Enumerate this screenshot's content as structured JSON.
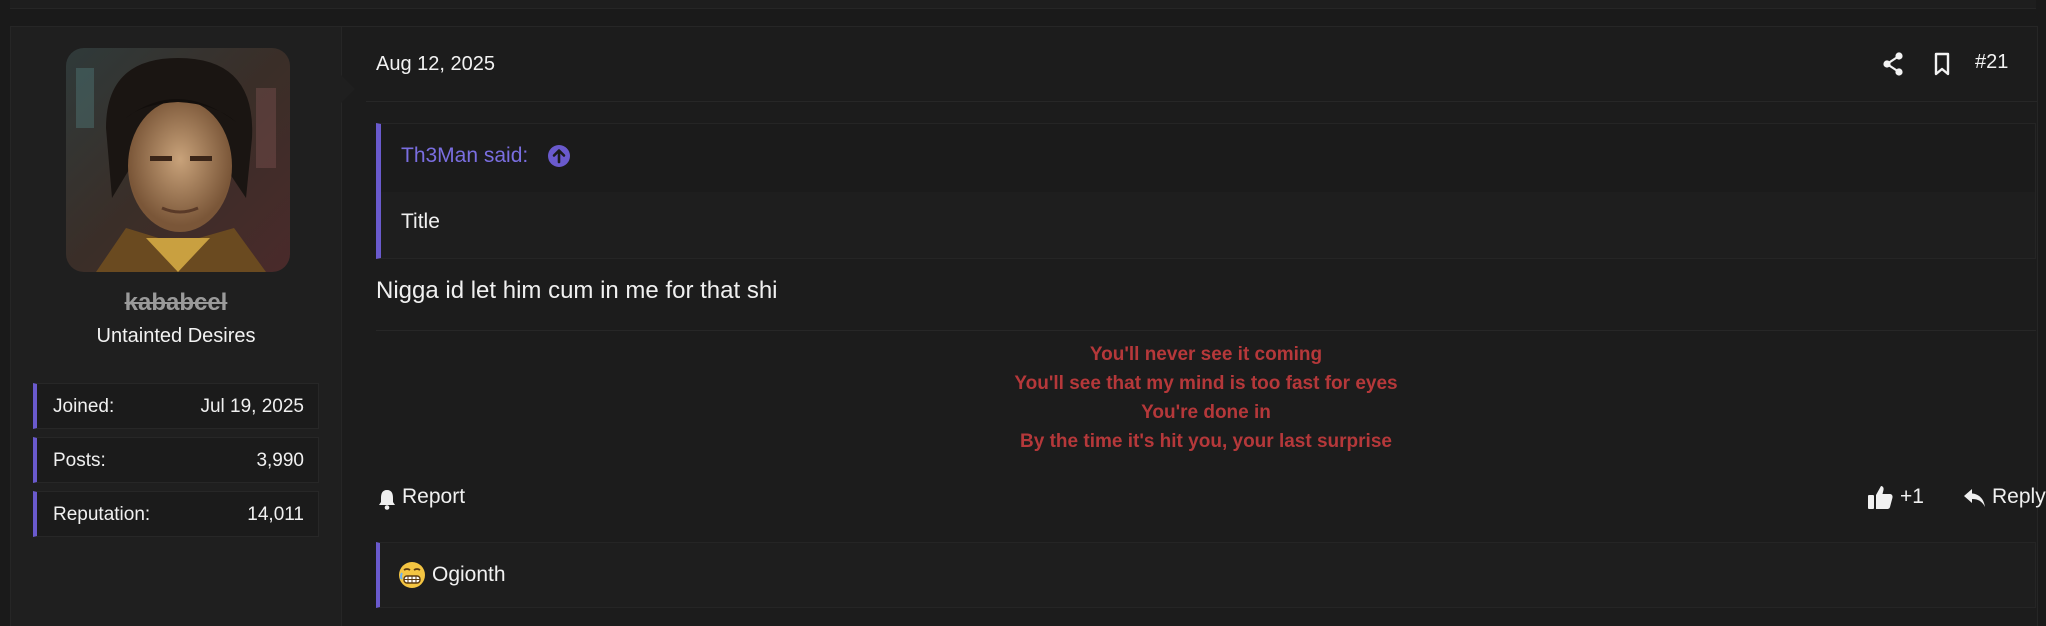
{
  "post": {
    "date": "Aug 12, 2025",
    "number": "#21",
    "author": {
      "username": "kababcel",
      "title": "Untainted Desires",
      "stats": [
        {
          "label": "Joined:",
          "value": "Jul 19, 2025"
        },
        {
          "label": "Posts:",
          "value": "3,990"
        },
        {
          "label": "Reputation:",
          "value": "14,011"
        }
      ]
    },
    "quote": {
      "author": "Th3Man said:",
      "body": "Title"
    },
    "message": "Nigga id let him cum in me for that shi",
    "signature": [
      "You'll never see it coming",
      "You'll see that my mind is too fast for eyes",
      "You're done in",
      "By the time it's hit you, your last surprise"
    ],
    "actions": {
      "report": "Report",
      "reaction_count": "+1",
      "reply": "Reply"
    },
    "reactions": {
      "users": "Ogionth"
    }
  },
  "colors": {
    "accent": "#6a5acd",
    "signature": "#b5383a",
    "background": "#1a1a1a"
  },
  "icons": [
    "share-icon",
    "bookmark-icon",
    "arrow-up-circle-icon",
    "bell-icon",
    "thumbs-up-icon",
    "reply-icon",
    "grimace-emoji-icon"
  ]
}
